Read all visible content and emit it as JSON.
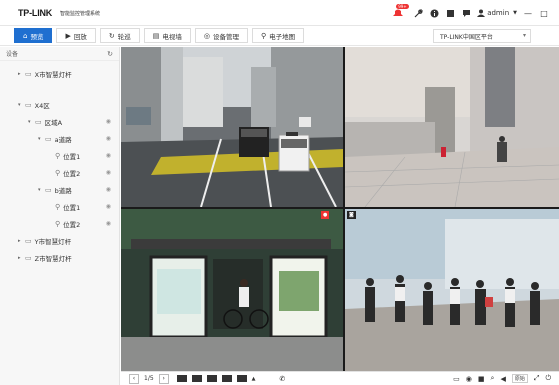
{
  "app": {
    "logo": "TP-LINK",
    "subtitle": "智能监控管理系统"
  },
  "header": {
    "alarm_badge": "99+",
    "user_name": "admin"
  },
  "nav": {
    "tabs": [
      {
        "label": "预览",
        "icon": "home-icon",
        "active": true
      },
      {
        "label": "回放",
        "icon": "playback-icon",
        "active": false
      },
      {
        "label": "轮巡",
        "icon": "cycle-icon",
        "active": false
      },
      {
        "label": "电视墙",
        "icon": "tv-wall-icon",
        "active": false
      },
      {
        "label": "设备管理",
        "icon": "device-icon",
        "active": false
      },
      {
        "label": "电子地图",
        "icon": "map-pin-icon",
        "active": false
      }
    ],
    "platform": "TP-LINK中国区平台"
  },
  "sidebar": {
    "title": "设备",
    "items": [
      {
        "label": "X市智慧灯杆",
        "level": 0,
        "toggle": "▸",
        "type": "folder"
      },
      {
        "label": "X4区",
        "level": 0,
        "toggle": "▾",
        "type": "folder"
      },
      {
        "label": "区域A",
        "level": 1,
        "toggle": "▾",
        "type": "folder"
      },
      {
        "label": "a道路",
        "level": 2,
        "toggle": "▾",
        "type": "folder"
      },
      {
        "label": "位置1",
        "level": 3,
        "toggle": "",
        "type": "camera"
      },
      {
        "label": "位置2",
        "level": 3,
        "toggle": "",
        "type": "camera"
      },
      {
        "label": "b道路",
        "level": 2,
        "toggle": "▾",
        "type": "folder"
      },
      {
        "label": "位置1",
        "level": 3,
        "toggle": "",
        "type": "camera"
      },
      {
        "label": "位置2",
        "level": 3,
        "toggle": "",
        "type": "camera"
      },
      {
        "label": "Y市智慧灯杆",
        "level": 0,
        "toggle": "▸",
        "type": "folder"
      },
      {
        "label": "Z市智慧灯杆",
        "level": 0,
        "toggle": "▸",
        "type": "folder"
      }
    ]
  },
  "video": {
    "cells": [
      {
        "badge": "",
        "scene": "street-traffic"
      },
      {
        "badge": "",
        "scene": "plaza"
      },
      {
        "badge": "",
        "scene": "bus-stop"
      },
      {
        "badge": "",
        "scene": "crowd"
      }
    ]
  },
  "bottom": {
    "page": "1/5",
    "ratio": "原始",
    "layout_caret": "▲"
  }
}
